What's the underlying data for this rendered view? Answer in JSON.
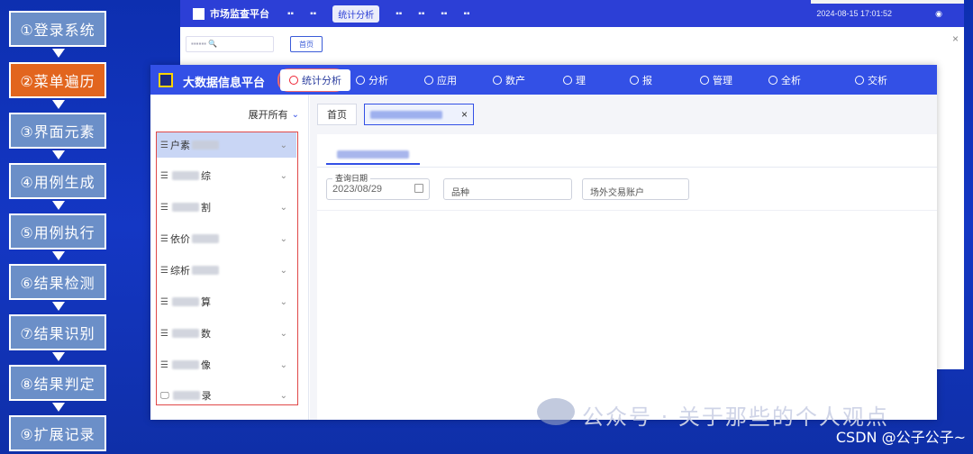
{
  "steps": [
    {
      "label": "①登录系统"
    },
    {
      "label": "②菜单遍历"
    },
    {
      "label": "③界面元素"
    },
    {
      "label": "④用例生成"
    },
    {
      "label": "⑤用例执行"
    },
    {
      "label": "⑥结果检测"
    },
    {
      "label": "⑦结果识别"
    },
    {
      "label": "⑧结果判定"
    },
    {
      "label": "⑨扩展记录"
    }
  ],
  "active_step_index": 1,
  "colors": {
    "step_bg": "#6b8fc8",
    "step_active_bg": "#e2651e",
    "topbar": "#3350e6",
    "menu_box_border": "#e04848"
  },
  "background_window": {
    "title": "市场监查平台",
    "nav_active": "统计分析",
    "datetime": "2024-08-15 17:01:52",
    "tab_home": "首页"
  },
  "main_window": {
    "title": "大数据信息平台",
    "nav": [
      {
        "label": "统计分析",
        "active": true
      },
      {
        "label": "分析"
      },
      {
        "label": "应用"
      },
      {
        "label": "数产"
      },
      {
        "label": "理"
      },
      {
        "label": "报"
      },
      {
        "label": "管理"
      },
      {
        "label": "全析"
      },
      {
        "label": "交析"
      }
    ],
    "sidebar": {
      "expand_all": "展开所有",
      "items": [
        {
          "label": "户素",
          "active": true
        },
        {
          "label": "综"
        },
        {
          "label": "割"
        },
        {
          "label": "依价"
        },
        {
          "label": "综析"
        },
        {
          "label": "算"
        },
        {
          "label": "数"
        },
        {
          "label": "像"
        },
        {
          "label": "录"
        }
      ]
    },
    "tabs": {
      "home": "首页",
      "close_symbol": "×"
    },
    "form": {
      "date_legend": "查询日期",
      "date_value": "2023/08/29",
      "variety_placeholder": "品种",
      "account_placeholder": "场外交易账户"
    }
  },
  "watermark": "公众号 · 关于那些的个人观点",
  "footer": "CSDN @公子公子~"
}
